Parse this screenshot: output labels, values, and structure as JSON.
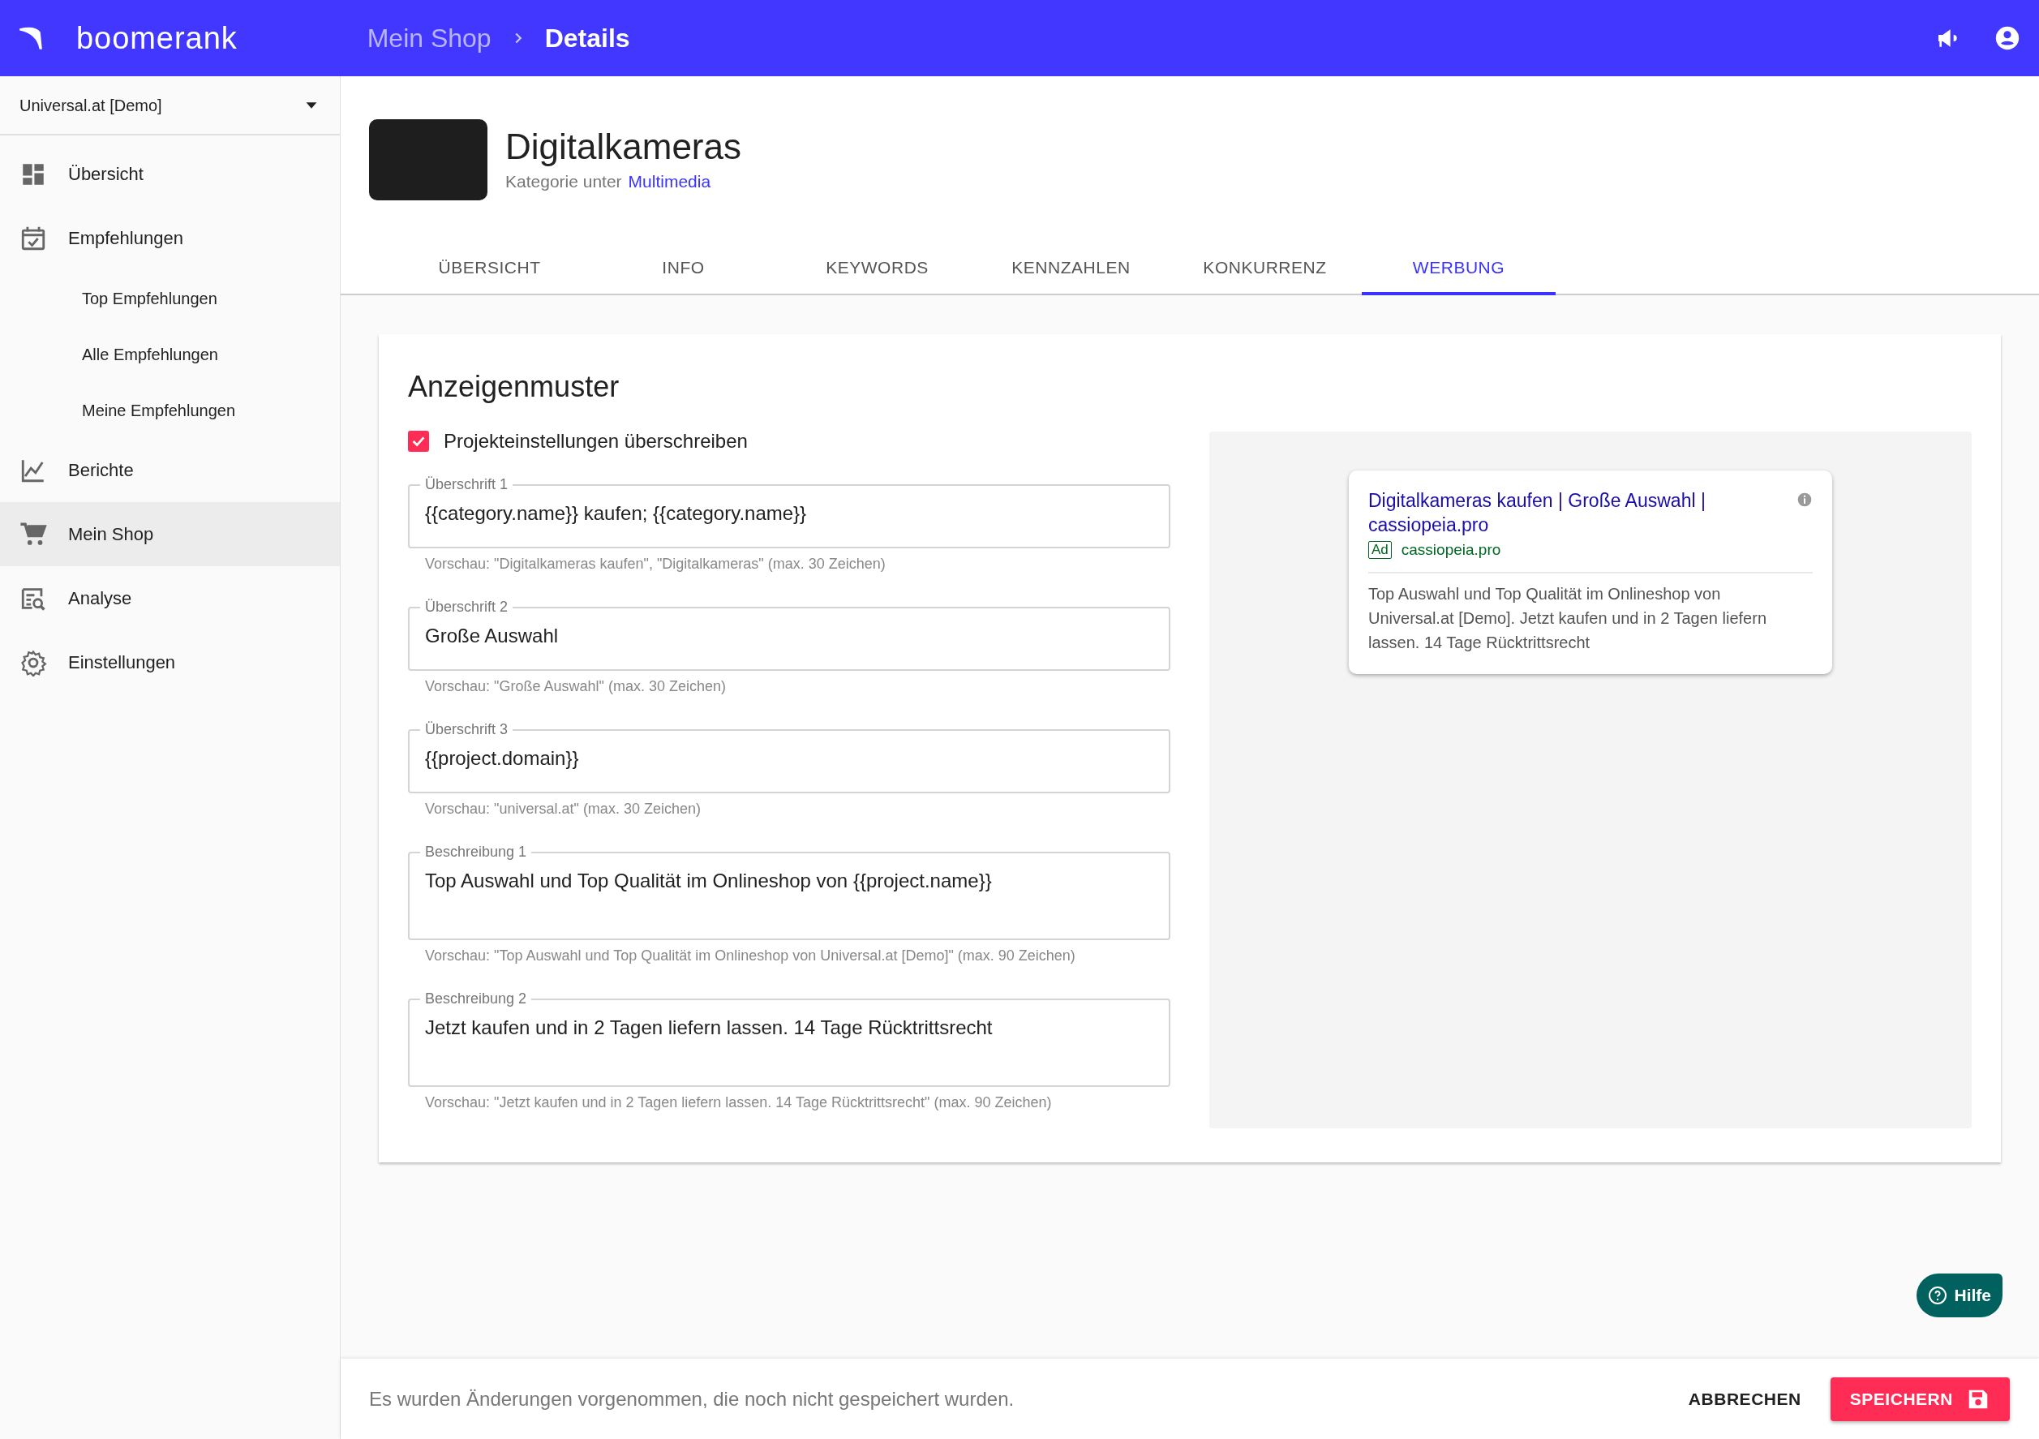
{
  "topbar": {
    "brand": "boomerank",
    "breadcrumb": [
      {
        "label": "Mein Shop",
        "current": false
      },
      {
        "label": "Details",
        "current": true
      }
    ]
  },
  "sidebar": {
    "project": "Universal.at [Demo]",
    "items": [
      {
        "label": "Übersicht",
        "selected": false
      },
      {
        "label": "Empfehlungen",
        "selected": false,
        "children": [
          {
            "label": "Top Empfehlungen",
            "selected": false
          },
          {
            "label": "Alle Empfehlungen",
            "selected": false
          },
          {
            "label": "Meine Empfehlungen",
            "selected": false
          }
        ]
      },
      {
        "label": "Berichte",
        "selected": false
      },
      {
        "label": "Mein Shop",
        "selected": true
      },
      {
        "label": "Analyse",
        "selected": false
      },
      {
        "label": "Einstellungen",
        "selected": false
      }
    ]
  },
  "category": {
    "title": "Digitalkameras",
    "subtitle": "Kategorie unter",
    "parent_link": "Multimedia"
  },
  "tabs": [
    {
      "label": "ÜBERSICHT",
      "selected": false
    },
    {
      "label": "INFO",
      "selected": false
    },
    {
      "label": "KEYWORDS",
      "selected": false
    },
    {
      "label": "KENNZAHLEN",
      "selected": false
    },
    {
      "label": "KONKURRENZ",
      "selected": false
    },
    {
      "label": "WERBUNG",
      "selected": true
    }
  ],
  "ad_template": {
    "title": "Anzeigenmuster",
    "override": {
      "label": "Projekteinstellungen überschreiben",
      "checked": true
    },
    "fields": [
      {
        "label": "Überschrift 1",
        "value": "{{category.name}} kaufen; {{category.name}}",
        "multiline": false,
        "hint": "Vorschau: \"Digitalkameras kaufen\", \"Digitalkameras\" (max. 30 Zeichen)"
      },
      {
        "label": "Überschrift 2",
        "value": "Große Auswahl",
        "multiline": false,
        "hint": "Vorschau: \"Große Auswahl\" (max. 30 Zeichen)"
      },
      {
        "label": "Überschrift 3",
        "value": "{{project.domain}}",
        "multiline": false,
        "hint": "Vorschau: \"universal.at\" (max. 30 Zeichen)"
      },
      {
        "label": "Beschreibung 1",
        "value": "Top Auswahl und Top Qualität im Onlineshop von {{project.name}}",
        "multiline": true,
        "hint": "Vorschau: \"Top Auswahl und Top Qualität im Onlineshop von Universal.at [Demo]\" (max. 90 Zeichen)"
      },
      {
        "label": "Beschreibung 2",
        "value": "Jetzt kaufen und in 2 Tagen liefern lassen. 14 Tage Rücktrittsrecht",
        "multiline": true,
        "hint": "Vorschau: \"Jetzt kaufen und in 2 Tagen liefern lassen. 14 Tage Rücktrittsrecht\" (max. 90 Zeichen)"
      }
    ],
    "preview": {
      "headline": "Digitalkameras kaufen | Große Auswahl | cassiopeia.pro",
      "badge": "Ad",
      "url": "cassiopeia.pro",
      "description": "Top Auswahl und Top Qualität im Onlineshop von Universal.at [Demo]. Jetzt kaufen und in 2 Tagen liefern lassen. 14 Tage Rücktrittsrecht"
    }
  },
  "help_button": "Hilfe",
  "footer": {
    "message": "Es wurden Änderungen vorgenommen, die noch nicht gespeichert wurden.",
    "cancel": "ABBRECHEN",
    "save": "SPEICHERN"
  }
}
